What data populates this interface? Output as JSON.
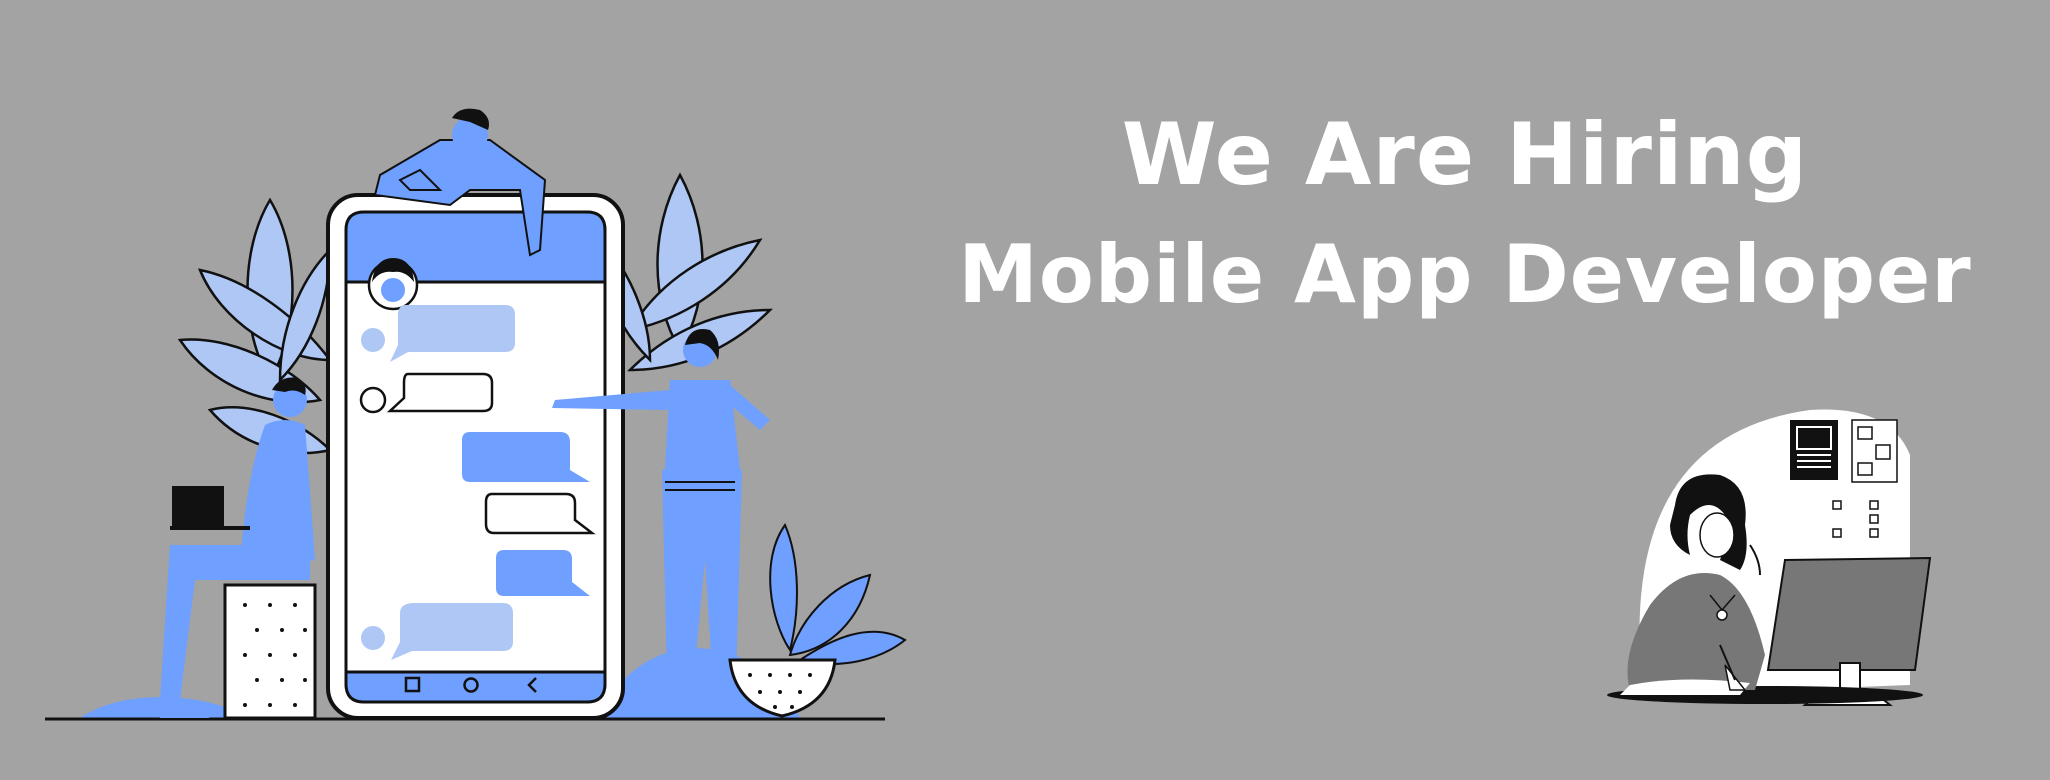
{
  "banner": {
    "headline_line1": "We Are Hiring",
    "headline_line2": "Mobile App Developer"
  },
  "colors": {
    "background": "#a3a3a3",
    "accent_blue": "#6f9fff",
    "light_blue": "#aec7f5",
    "text": "#ffffff",
    "ink": "#111111"
  },
  "illustrations": {
    "left": "team-with-giant-phone-chat-illustration",
    "right": "woman-at-computer-illustration"
  }
}
